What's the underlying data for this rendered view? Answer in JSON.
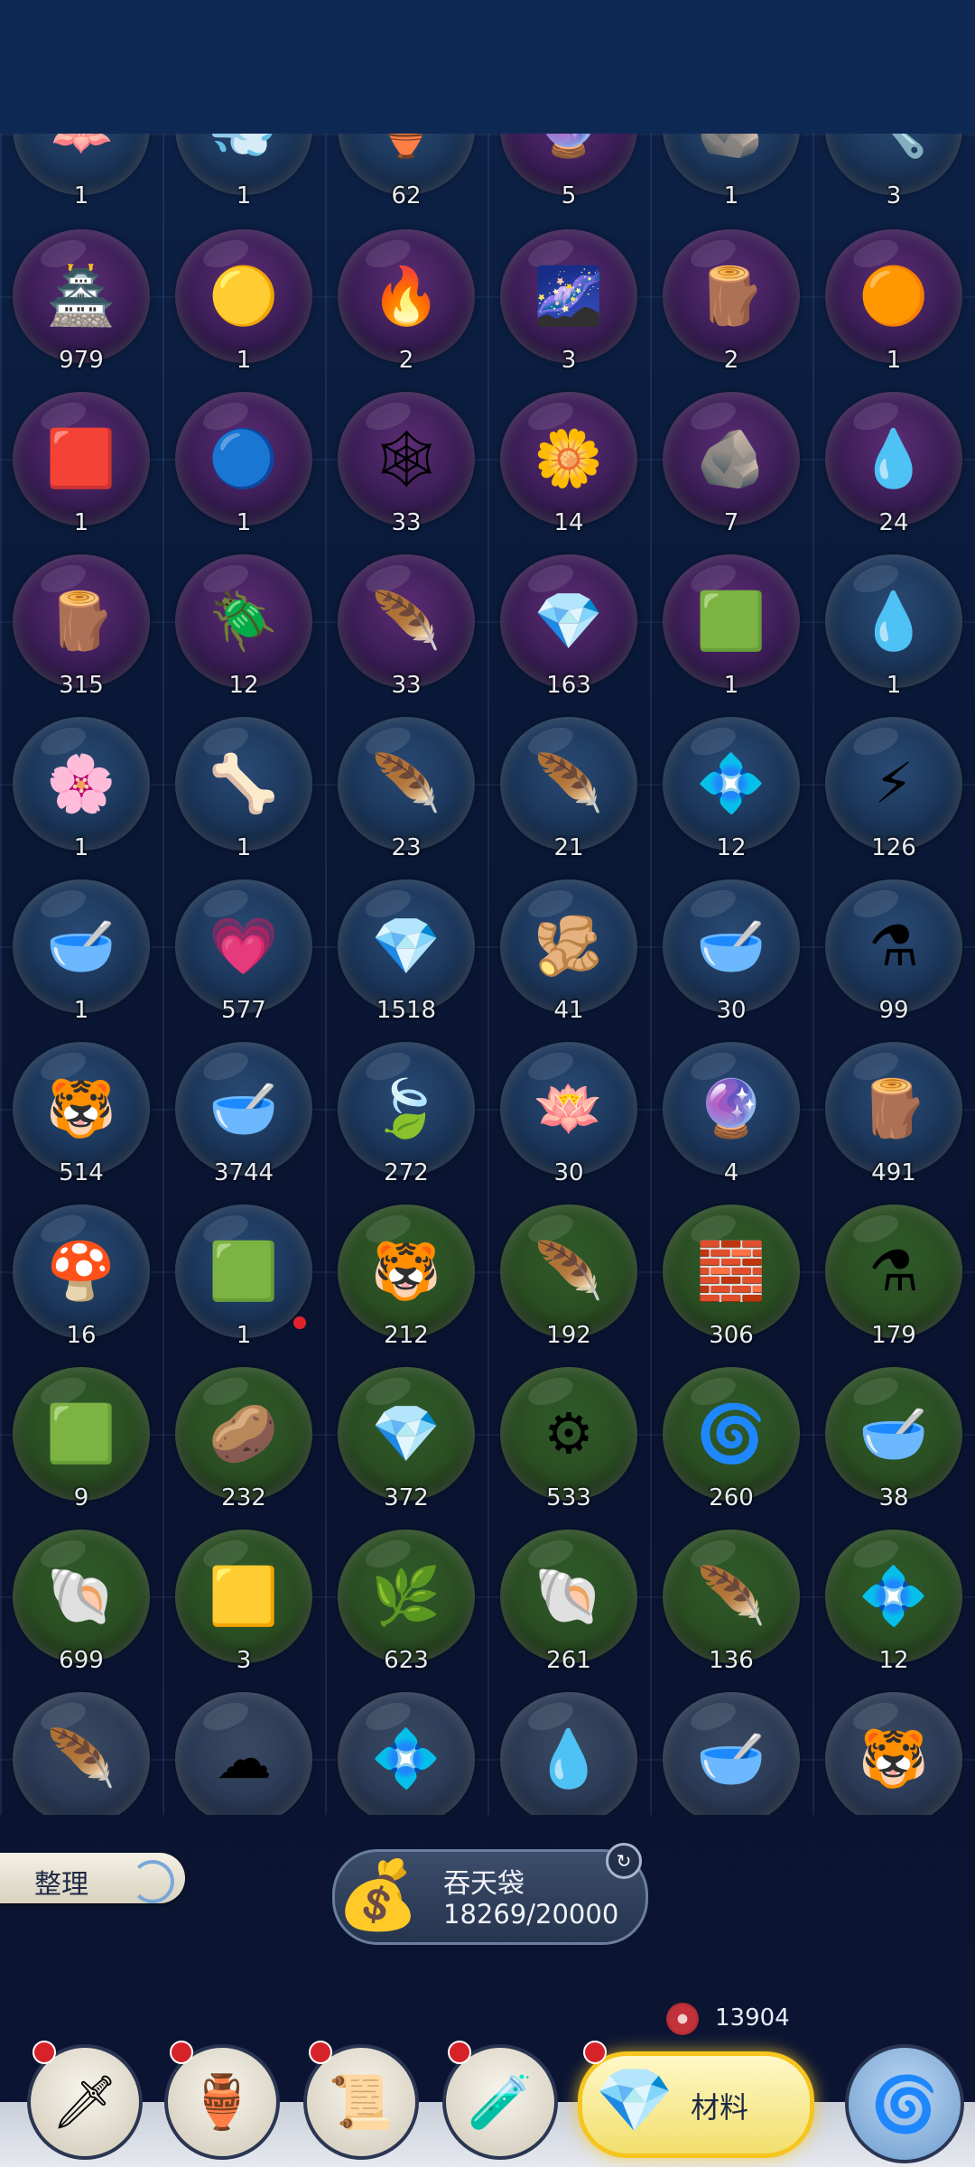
{
  "inventory": {
    "rows": [
      [
        {
          "icon": "blue-lotus-icon",
          "glyph": "🪷",
          "count": "1",
          "tint": "blue"
        },
        {
          "icon": "spirit-wisp-icon",
          "glyph": "💨",
          "count": "1",
          "tint": "blue"
        },
        {
          "icon": "porcelain-jar-icon",
          "glyph": "🏺",
          "count": "62",
          "tint": "blue"
        },
        {
          "icon": "purple-crystal-icon",
          "glyph": "🔮",
          "count": "5",
          "tint": "purple"
        },
        {
          "icon": "stone-tablet-icon",
          "glyph": "🪨",
          "count": "1",
          "tint": "blue"
        },
        {
          "icon": "tool-bundle-icon",
          "glyph": "🔧",
          "count": "3",
          "tint": "blue"
        }
      ],
      [
        {
          "icon": "pagoda-box-icon",
          "glyph": "🏯",
          "count": "979",
          "tint": "purple"
        },
        {
          "icon": "golden-orb-icon",
          "glyph": "🟡",
          "count": "1",
          "tint": "purple"
        },
        {
          "icon": "fire-orb-icon",
          "glyph": "🔥",
          "count": "2",
          "tint": "purple"
        },
        {
          "icon": "galaxy-orb-icon",
          "glyph": "🌌",
          "count": "3",
          "tint": "purple"
        },
        {
          "icon": "sprouting-log-icon",
          "glyph": "🪵",
          "count": "2",
          "tint": "purple"
        },
        {
          "icon": "amber-orb-icon",
          "glyph": "🟠",
          "count": "1",
          "tint": "purple"
        }
      ],
      [
        {
          "icon": "red-gem-icon",
          "glyph": "🟥",
          "count": "1",
          "tint": "purple"
        },
        {
          "icon": "water-orb-icon",
          "glyph": "🔵",
          "count": "1",
          "tint": "purple"
        },
        {
          "icon": "spider-web-icon",
          "glyph": "🕸",
          "count": "33",
          "tint": "purple"
        },
        {
          "icon": "golden-blossom-icon",
          "glyph": "🌼",
          "count": "14",
          "tint": "purple"
        },
        {
          "icon": "coal-ore-icon",
          "glyph": "🪨",
          "count": "7",
          "tint": "purple"
        },
        {
          "icon": "cyan-flame-icon",
          "glyph": "💧",
          "count": "24",
          "tint": "purple"
        }
      ],
      [
        {
          "icon": "thunder-wood-icon",
          "glyph": "🪵",
          "count": "315",
          "tint": "purple"
        },
        {
          "icon": "black-beetle-icon",
          "glyph": "🪲",
          "count": "12",
          "tint": "purple"
        },
        {
          "icon": "golden-feather-icon",
          "glyph": "🪶",
          "count": "33",
          "tint": "purple"
        },
        {
          "icon": "violet-crystal-icon",
          "glyph": "💎",
          "count": "163",
          "tint": "purple"
        },
        {
          "icon": "jade-shard-icon",
          "glyph": "🟩",
          "count": "1",
          "tint": "purple"
        },
        {
          "icon": "pink-droplet-icon",
          "glyph": "💧",
          "count": "1",
          "tint": "blue"
        }
      ],
      [
        {
          "icon": "white-flowers-icon",
          "glyph": "🌸",
          "count": "1",
          "tint": "blue"
        },
        {
          "icon": "skeleton-hand-icon",
          "glyph": "🦴",
          "count": "1",
          "tint": "blue"
        },
        {
          "icon": "golden-feather-icon",
          "glyph": "🪶",
          "count": "23",
          "tint": "blue"
        },
        {
          "icon": "golden-feather-icon",
          "glyph": "🪶",
          "count": "21",
          "tint": "blue"
        },
        {
          "icon": "quartz-crystal-icon",
          "glyph": "💠",
          "count": "12",
          "tint": "blue"
        },
        {
          "icon": "lightning-bamboo-icon",
          "glyph": "⚡",
          "count": "126",
          "tint": "blue"
        }
      ],
      [
        {
          "icon": "blood-bowl-icon",
          "glyph": "🥣",
          "count": "1",
          "tint": "blue"
        },
        {
          "icon": "pink-gem-icon",
          "glyph": "💗",
          "count": "577",
          "tint": "blue"
        },
        {
          "icon": "violet-crystal-icon",
          "glyph": "💎",
          "count": "1518",
          "tint": "blue"
        },
        {
          "icon": "ginseng-root-icon",
          "glyph": "🫚",
          "count": "41",
          "tint": "blue"
        },
        {
          "icon": "blood-bowl-icon",
          "glyph": "🥣",
          "count": "30",
          "tint": "blue"
        },
        {
          "icon": "elixir-flask-icon",
          "glyph": "⚗",
          "count": "99",
          "tint": "blue"
        }
      ],
      [
        {
          "icon": "tiger-pelt-icon",
          "glyph": "🐯",
          "count": "514",
          "tint": "blue"
        },
        {
          "icon": "blood-bowl-icon",
          "glyph": "🥣",
          "count": "3744",
          "tint": "blue"
        },
        {
          "icon": "cyan-petal-icon",
          "glyph": "🍃",
          "count": "272",
          "tint": "blue"
        },
        {
          "icon": "white-lotus-icon",
          "glyph": "🪷",
          "count": "30",
          "tint": "blue"
        },
        {
          "icon": "dark-amethyst-icon",
          "glyph": "🔮",
          "count": "4",
          "tint": "blue"
        },
        {
          "icon": "sprouting-log-icon",
          "glyph": "🪵",
          "count": "491",
          "tint": "blue"
        }
      ],
      [
        {
          "icon": "mushroom-cluster-icon",
          "glyph": "🍄",
          "count": "16",
          "tint": "blue"
        },
        {
          "icon": "jade-shard-icon",
          "glyph": "🟩",
          "count": "1",
          "tint": "blue"
        },
        {
          "icon": "tiger-pelt-icon",
          "glyph": "🐯",
          "count": "212",
          "tint": "green"
        },
        {
          "icon": "golden-feather-icon",
          "glyph": "🪶",
          "count": "192",
          "tint": "green"
        },
        {
          "icon": "red-wax-icon",
          "glyph": "🧱",
          "count": "306",
          "tint": "green"
        },
        {
          "icon": "elixir-flask-icon",
          "glyph": "⚗",
          "count": "179",
          "tint": "green"
        }
      ],
      [
        {
          "icon": "jade-shard-icon",
          "glyph": "🟩",
          "count": "9",
          "tint": "green"
        },
        {
          "icon": "river-stone-icon",
          "glyph": "🥔",
          "count": "232",
          "tint": "green"
        },
        {
          "icon": "violet-crystal-icon",
          "glyph": "💎",
          "count": "372",
          "tint": "green"
        },
        {
          "icon": "iron-gear-icon",
          "glyph": "⚙",
          "count": "533",
          "tint": "green"
        },
        {
          "icon": "blue-spirit-orb-icon",
          "glyph": "🌀",
          "count": "260",
          "tint": "green"
        },
        {
          "icon": "blood-bowl-icon",
          "glyph": "🥣",
          "count": "38",
          "tint": "green"
        }
      ],
      [
        {
          "icon": "gray-scale-icon",
          "glyph": "🐚",
          "count": "699",
          "tint": "green"
        },
        {
          "icon": "gold-nugget-icon",
          "glyph": "🟨",
          "count": "3",
          "tint": "green"
        },
        {
          "icon": "dried-branch-icon",
          "glyph": "🌿",
          "count": "623",
          "tint": "green"
        },
        {
          "icon": "gray-scale-icon",
          "glyph": "🐚",
          "count": "261",
          "tint": "green"
        },
        {
          "icon": "golden-feather-icon",
          "glyph": "🪶",
          "count": "136",
          "tint": "green"
        },
        {
          "icon": "silver-crystal-icon",
          "glyph": "💠",
          "count": "12",
          "tint": "green"
        }
      ],
      [
        {
          "icon": "golden-feather-icon",
          "glyph": "🪶",
          "count": "",
          "tint": "gray"
        },
        {
          "icon": "cloud-eggs-icon",
          "glyph": "☁",
          "count": "",
          "tint": "gray"
        },
        {
          "icon": "gray-crystals-icon",
          "glyph": "💠",
          "count": "",
          "tint": "gray"
        },
        {
          "icon": "cyan-flame-icon",
          "glyph": "💧",
          "count": "",
          "tint": "gray"
        },
        {
          "icon": "blood-bowl-icon",
          "glyph": "🥣",
          "count": "",
          "tint": "gray"
        },
        {
          "icon": "tiger-pelt-icon",
          "glyph": "🐯",
          "count": "",
          "tint": "gray"
        }
      ]
    ]
  },
  "sort_button": {
    "label": "整理"
  },
  "bag": {
    "title": "吞天袋",
    "capacity": "18269/20000",
    "icon": "money-bag-icon"
  },
  "currency": {
    "value": "13904",
    "icon": "red-spiral-token-icon"
  },
  "nav": {
    "items": [
      {
        "name": "nav-weapons",
        "glyph": "🗡",
        "icon": "sword-emblem-icon",
        "badge": true
      },
      {
        "name": "nav-consumables",
        "glyph": "🏺",
        "icon": "pouch-jar-icon",
        "badge": true
      },
      {
        "name": "nav-scrolls",
        "glyph": "📜",
        "icon": "scroll-book-icon",
        "badge": true
      },
      {
        "name": "nav-potions",
        "glyph": "🧪",
        "icon": "potion-gourd-icon",
        "badge": true
      }
    ],
    "active": {
      "label": "材料",
      "icon": "crystal-materials-icon",
      "glyph": "💎",
      "badge": true
    },
    "swirl": {
      "icon": "golden-swirl-icon",
      "glyph": "🌀"
    }
  }
}
